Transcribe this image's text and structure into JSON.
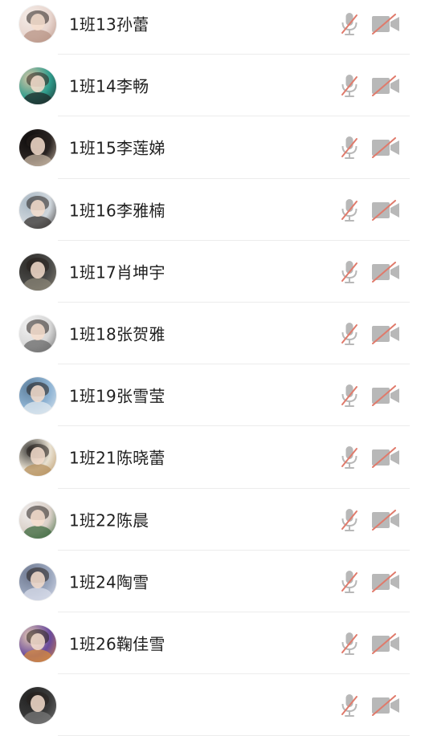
{
  "participants": [
    {
      "name": "1班13孙蕾",
      "mic": "muted",
      "camera": "off",
      "avatar_colors": [
        "#e8d6cf",
        "#b89486",
        "#f4ece7"
      ]
    },
    {
      "name": "1班14李畅",
      "mic": "muted",
      "camera": "off",
      "avatar_colors": [
        "#2f9c8c",
        "#1d2b2a",
        "#d9c6a5"
      ]
    },
    {
      "name": "1班15李莲娣",
      "mic": "muted",
      "camera": "off",
      "avatar_colors": [
        "#2a2422",
        "#c5b4a2",
        "#0e0c0c"
      ]
    },
    {
      "name": "1班16李雅楠",
      "mic": "muted",
      "camera": "off",
      "avatar_colors": [
        "#cfd6dc",
        "#3a3533",
        "#a7b6c2"
      ]
    },
    {
      "name": "1班17肖坤宇",
      "mic": "muted",
      "camera": "off",
      "avatar_colors": [
        "#4a4a48",
        "#8a8476",
        "#2e2c29"
      ]
    },
    {
      "name": "1班18张贺雅",
      "mic": "muted",
      "camera": "off",
      "avatar_colors": [
        "#d7d7d7",
        "#6a6a6a",
        "#f2f2f2"
      ]
    },
    {
      "name": "1班19张雪莹",
      "mic": "muted",
      "camera": "off",
      "avatar_colors": [
        "#8fb4d4",
        "#dfe8ef",
        "#5e7f9c"
      ]
    },
    {
      "name": "1班21陈晓蕾",
      "mic": "muted",
      "camera": "off",
      "avatar_colors": [
        "#e9e1d1",
        "#b7925f",
        "#3b3a38"
      ]
    },
    {
      "name": "1班22陈晨",
      "mic": "muted",
      "camera": "off",
      "avatar_colors": [
        "#d9cfc7",
        "#3d6a3f",
        "#f1eeee"
      ]
    },
    {
      "name": "1班24陶雪",
      "mic": "muted",
      "camera": "off",
      "avatar_colors": [
        "#9aa6bd",
        "#d8dcea",
        "#6f7990"
      ]
    },
    {
      "name": "1班26鞠佳雪",
      "mic": "muted",
      "camera": "off",
      "avatar_colors": [
        "#6a4a9c",
        "#d6893e",
        "#e6cbb2"
      ]
    },
    {
      "name": "",
      "mic": "muted",
      "camera": "off",
      "avatar_colors": [
        "#3a3a3a",
        "#777777",
        "#222222"
      ]
    }
  ],
  "icons": {
    "mic_muted": "mic-muted-icon",
    "camera_off": "camera-off-icon"
  },
  "colors": {
    "icon_gray": "#b8b8b8",
    "slash_red": "#e07a6b",
    "name_text": "#1f1f1f",
    "divider": "#ececec"
  }
}
